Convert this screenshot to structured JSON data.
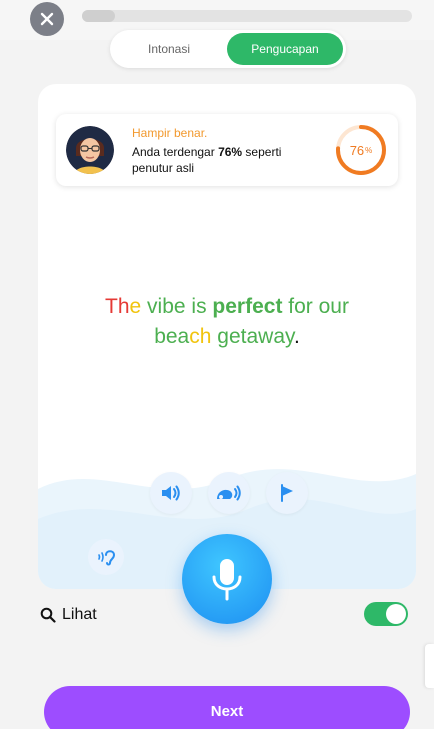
{
  "header": {
    "progress_fraction": 0.1
  },
  "mode_toggle": {
    "left_label": "Intonasi",
    "right_label": "Pengucapan",
    "active": "Pengucapan"
  },
  "feedback": {
    "title": "Hampir benar.",
    "text_prefix": "Anda terdengar ",
    "score_text": "76%",
    "text_suffix": " seperti penutur asli",
    "score_value": "76",
    "score_unit": "%",
    "score_fraction": 0.76
  },
  "sentence": {
    "words": [
      {
        "text": "Th",
        "color": "#e53935"
      },
      {
        "text": "e",
        "color": "#f1c40f"
      },
      {
        "text": " vibe is ",
        "color": "#4caf50"
      },
      {
        "text": "perfect",
        "color": "#4caf50",
        "bold": true
      },
      {
        "text": " for our",
        "color": "#4caf50"
      }
    ],
    "line2": [
      {
        "text": "bea",
        "color": "#4caf50"
      },
      {
        "text": "ch",
        "color": "#f1c40f"
      },
      {
        "text": " ge",
        "color": "#4caf50"
      },
      {
        "text": "taway",
        "color": "#4caf50"
      },
      {
        "text": ".",
        "color": "#111111"
      }
    ]
  },
  "controls": {
    "buttons": [
      "speaker-icon",
      "slow-speaker-icon",
      "flag-icon"
    ],
    "ear": "ear-icon",
    "mic": "microphone-icon"
  },
  "footer": {
    "lihat_label": "Lihat",
    "toggle_on": true,
    "next_label": "Next"
  },
  "colors": {
    "green": "#2eb868",
    "purple": "#9d4dff",
    "orange": "#f07b22",
    "blue": "#1d8ef1"
  }
}
